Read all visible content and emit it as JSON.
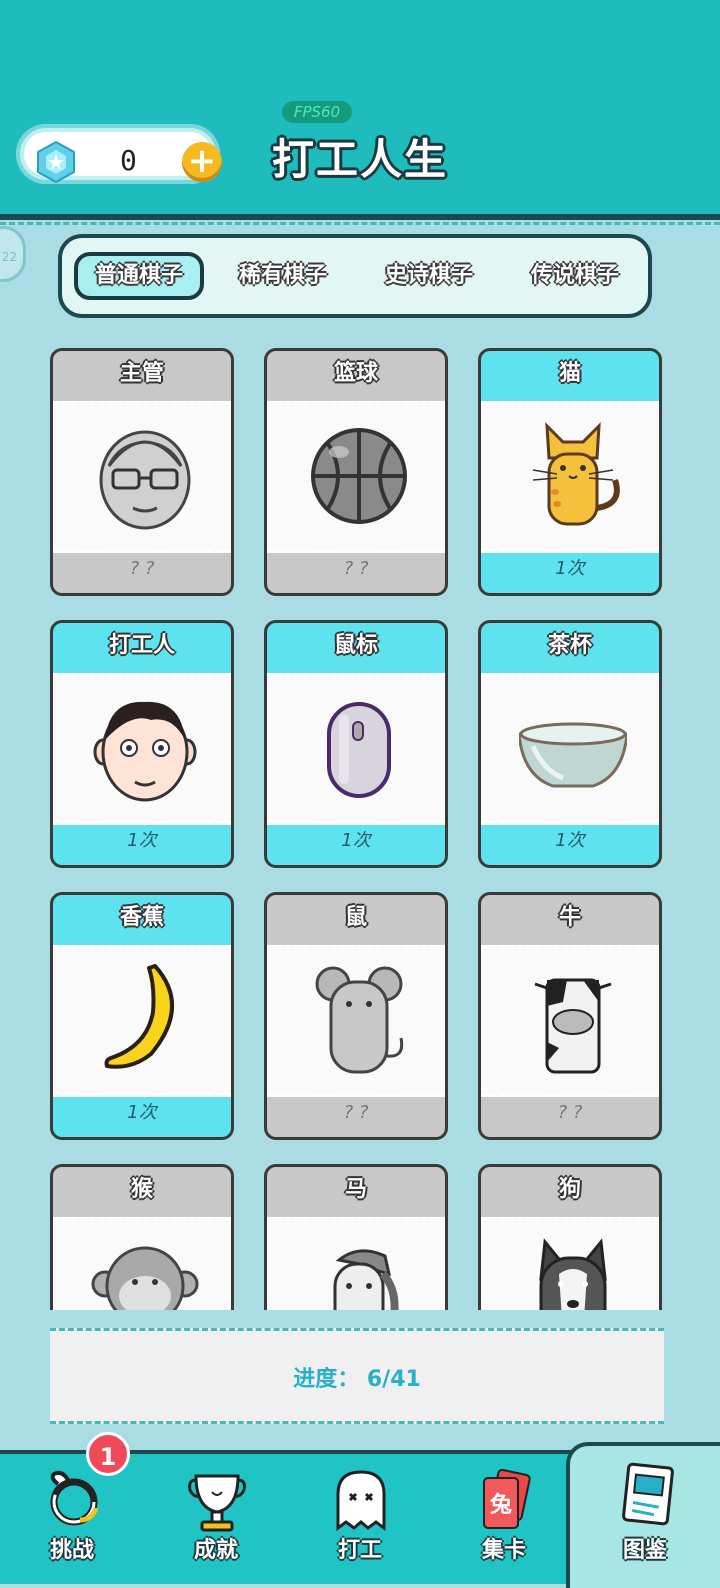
{
  "header": {
    "fps_label": "FPS60",
    "title": "打工人生",
    "gem_count": "0",
    "side_badge": "22"
  },
  "tabs": [
    {
      "label": "普通棋子",
      "active": true
    },
    {
      "label": "稀有棋子",
      "active": false
    },
    {
      "label": "史诗棋子",
      "active": false
    },
    {
      "label": "传说棋子",
      "active": false
    }
  ],
  "cards": [
    {
      "name": "主管",
      "count": "? ?",
      "unlocked": false,
      "icon": "supervisor-icon"
    },
    {
      "name": "篮球",
      "count": "? ?",
      "unlocked": false,
      "icon": "basketball-icon"
    },
    {
      "name": "猫",
      "count": "1次",
      "unlocked": true,
      "icon": "cat-icon"
    },
    {
      "name": "打工人",
      "count": "1次",
      "unlocked": true,
      "icon": "worker-icon"
    },
    {
      "name": "鼠标",
      "count": "1次",
      "unlocked": true,
      "icon": "mouse-device-icon"
    },
    {
      "name": "茶杯",
      "count": "1次",
      "unlocked": true,
      "icon": "teacup-icon"
    },
    {
      "name": "香蕉",
      "count": "1次",
      "unlocked": true,
      "icon": "banana-icon"
    },
    {
      "name": "鼠",
      "count": "? ?",
      "unlocked": false,
      "icon": "rat-icon"
    },
    {
      "name": "牛",
      "count": "? ?",
      "unlocked": false,
      "icon": "cow-icon"
    },
    {
      "name": "猴",
      "count": "",
      "unlocked": false,
      "icon": "monkey-icon"
    },
    {
      "name": "马",
      "count": "",
      "unlocked": false,
      "icon": "horse-icon"
    },
    {
      "name": "狗",
      "count": "",
      "unlocked": false,
      "icon": "dog-icon"
    }
  ],
  "progress": {
    "label": "进度： 6/41",
    "collected": 6,
    "total": 41
  },
  "nav": [
    {
      "label": "挑战",
      "icon": "challenge-icon",
      "badge": "1",
      "active": false
    },
    {
      "label": "成就",
      "icon": "trophy-icon",
      "active": false
    },
    {
      "label": "打工",
      "icon": "ghost-icon",
      "active": false
    },
    {
      "label": "集卡",
      "icon": "card-collect-icon",
      "card_text": "兔",
      "active": false
    },
    {
      "label": "图鉴",
      "icon": "handbook-icon",
      "active": true
    }
  ],
  "colors": {
    "top_bar": "#1ebcbc",
    "background": "#a9dde3",
    "unlocked_card": "#5ce3ef",
    "locked_card": "#c8c8c8",
    "progress_text": "#28b0c8"
  }
}
